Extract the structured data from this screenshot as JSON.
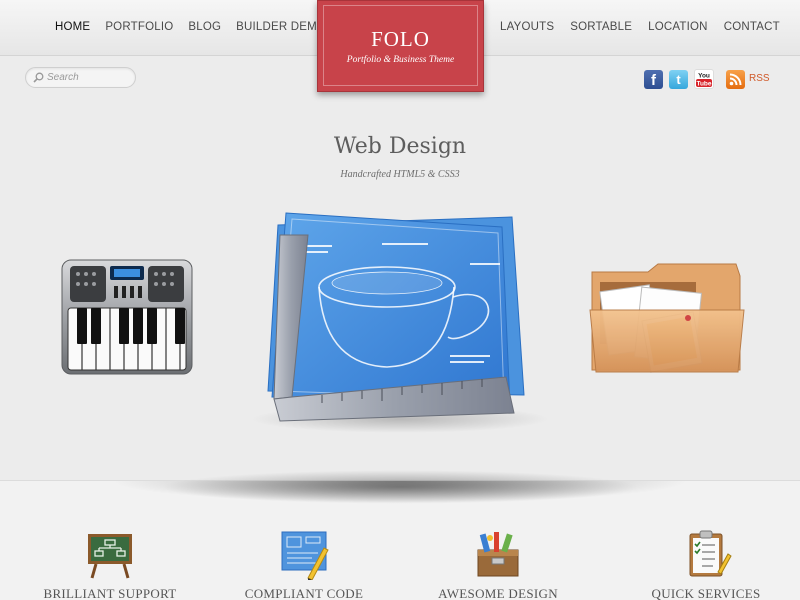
{
  "nav": {
    "left": [
      {
        "label": "HOME",
        "active": true
      },
      {
        "label": "PORTFOLIO"
      },
      {
        "label": "BLOG"
      },
      {
        "label": "BUILDER DEMOS"
      }
    ],
    "right": [
      {
        "label": "LAYOUTS"
      },
      {
        "label": "SORTABLE"
      },
      {
        "label": "LOCATION"
      },
      {
        "label": "CONTACT"
      }
    ]
  },
  "logo": {
    "title": "FOLO",
    "tagline": "Portfolio & Business Theme",
    "color": "#c8434a"
  },
  "search": {
    "placeholder": "Search"
  },
  "social": {
    "icons": [
      "facebook-icon",
      "twitter-icon",
      "youtube-icon",
      "rss-icon"
    ],
    "rss_label": "RSS",
    "youtube_label": "You Tube"
  },
  "hero": {
    "title": "Web Design",
    "subtitle": "Handcrafted HTML5 & CSS3"
  },
  "features": [
    {
      "label": "BRILLIANT SUPPORT",
      "icon": "chalkboard-icon"
    },
    {
      "label": "COMPLIANT CODE",
      "icon": "blueprint-icon"
    },
    {
      "label": "AWESOME DESIGN",
      "icon": "toolbox-icon"
    },
    {
      "label": "QUICK SERVICES",
      "icon": "clipboard-icon"
    }
  ]
}
